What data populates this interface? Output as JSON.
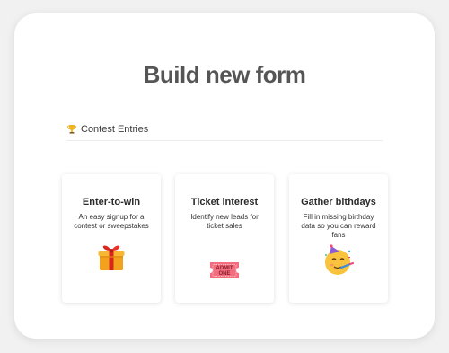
{
  "page": {
    "title": "Build new form"
  },
  "section": {
    "icon": "trophy-icon",
    "label": "Contest Entries"
  },
  "cards": [
    {
      "title": "Enter-to-win",
      "description": "An easy signup for a contest or sweepstakes",
      "icon": "gift-icon"
    },
    {
      "title": "Ticket interest",
      "description": "Identify new leads for ticket sales",
      "icon": "admission-ticket-icon",
      "icon_text": [
        "ADMIT",
        "ONE"
      ]
    },
    {
      "title": "Gather bithdays",
      "description": "Fill in missing birthday data so you can reward fans",
      "icon": "partying-face-icon"
    }
  ],
  "colors": {
    "background": "#f1f1f1",
    "panel": "#ffffff",
    "title": "#555555",
    "card_shadow": "rgba(0,0,0,0.12)"
  }
}
